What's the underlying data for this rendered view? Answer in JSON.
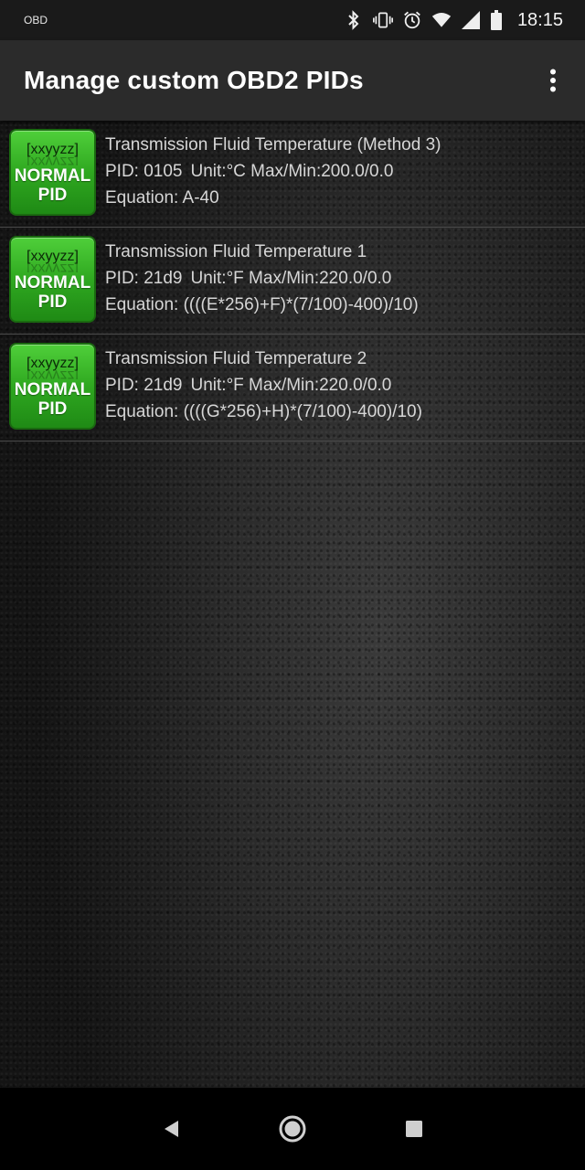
{
  "status_bar": {
    "app_label": "OBD",
    "time": "18:15",
    "icons": [
      "bluetooth-icon",
      "vibrate-icon",
      "alarm-icon",
      "wifi-icon",
      "signal-icon",
      "battery-icon"
    ]
  },
  "app_bar": {
    "title": "Manage custom OBD2 PIDs",
    "menu_icon": "overflow-menu-icon"
  },
  "pids": [
    {
      "badge_top": "[xxyyzz]",
      "badge_line1": "NORMAL",
      "badge_line2": "PID",
      "name": "Transmission Fluid Temperature (Method 3)",
      "pid": "PID: 0105",
      "unit_range": "Unit:°C Max/Min:200.0/0.0",
      "equation": "Equation: A-40"
    },
    {
      "badge_top": "[xxyyzz]",
      "badge_line1": "NORMAL",
      "badge_line2": "PID",
      "name": "Transmission Fluid Temperature 1",
      "pid": "PID: 21d9",
      "unit_range": "Unit:°F Max/Min:220.0/0.0",
      "equation": "Equation: ((((E*256)+F)*(7/100)-400)/10)"
    },
    {
      "badge_top": "[xxyyzz]",
      "badge_line1": "NORMAL",
      "badge_line2": "PID",
      "name": "Transmission Fluid Temperature 2",
      "pid": "PID: 21d9",
      "unit_range": "Unit:°F Max/Min:220.0/0.0",
      "equation": "Equation: ((((G*256)+H)*(7/100)-400)/10)"
    }
  ],
  "nav_bar": {
    "icons": [
      "back-icon",
      "home-icon",
      "recents-icon"
    ]
  },
  "colors": {
    "app_bar": "#2b2b2b",
    "status_bar": "#1a1a1a",
    "badge_green": "#2fa820",
    "text": "#d6d6d6"
  }
}
